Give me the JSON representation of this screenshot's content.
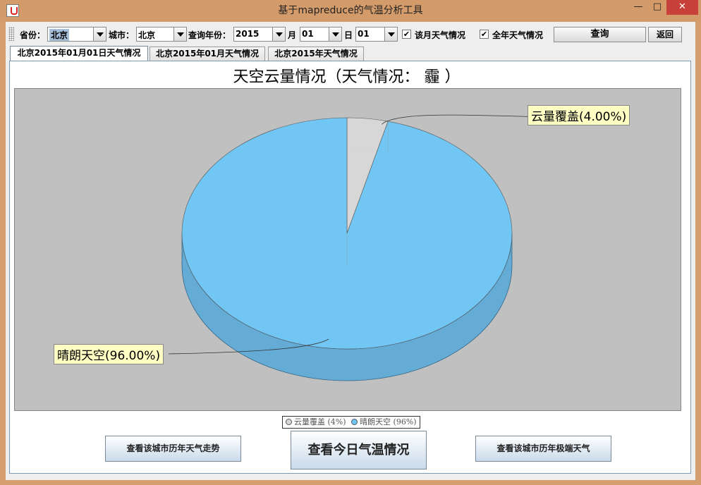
{
  "window": {
    "title": "基于mapreduce的气温分析工具",
    "minimize": "—",
    "maximize": "□",
    "close": "✕"
  },
  "toolbar": {
    "province_label": "省份：",
    "province_value": "北京",
    "city_label": "城市：",
    "city_value": "北京",
    "year_label": "查询年份：",
    "year_value": "2015",
    "month_label": "月",
    "month_value": "01",
    "day_label": "日",
    "day_value": "01",
    "month_weather_label": "该月天气情况",
    "month_weather_checked": true,
    "year_weather_label": "全年天气情况",
    "year_weather_checked": true,
    "query_label": "查询",
    "back_label": "返回"
  },
  "tabs": [
    {
      "label": "北京2015年01月01日天气情况",
      "active": true
    },
    {
      "label": "北京2015年01月天气情况",
      "active": false
    },
    {
      "label": "北京2015年天气情况",
      "active": false
    }
  ],
  "chart_data": {
    "type": "pie",
    "title": "天空云量情况（天气情况：   霾 ）",
    "categories": [
      "云量覆盖",
      "晴朗天空"
    ],
    "values": [
      4,
      96
    ],
    "labels": [
      "云量覆盖(4.00%)",
      "晴朗天空(96.00%)"
    ],
    "legend": [
      "云量覆盖 (4%)",
      "晴朗天空 (96%)"
    ],
    "legend_position": "bottom",
    "colors": [
      "#d8d8d8",
      "#6ec6f6"
    ],
    "style": "3d"
  },
  "buttons": {
    "history_trend": "查看该城市历年天气走势",
    "today_temp": "查看今日气温情况",
    "history_extreme": "查看该城市历年极端天气"
  }
}
